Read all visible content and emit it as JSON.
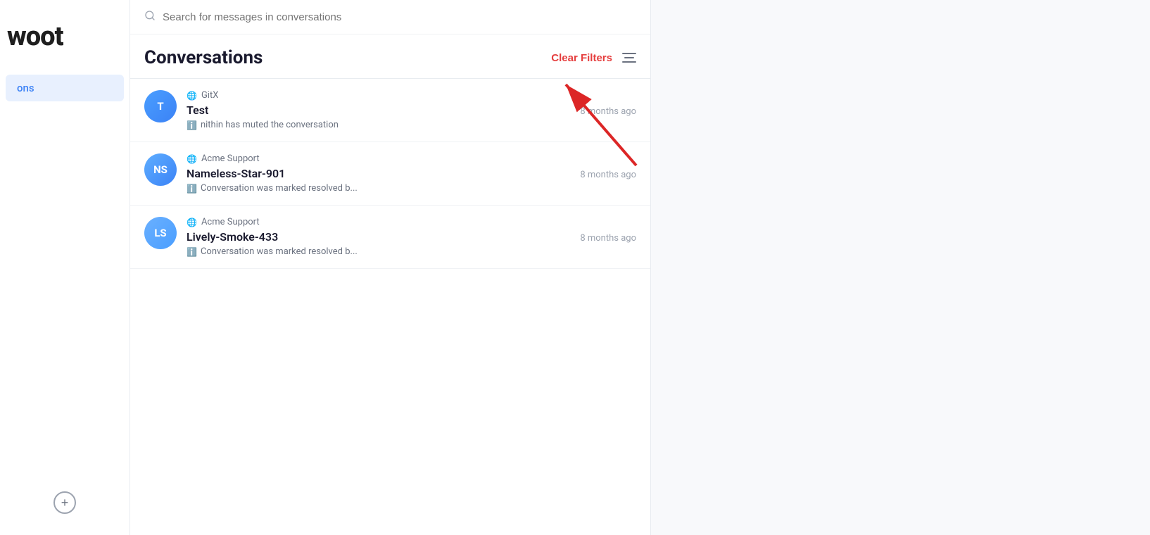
{
  "sidebar": {
    "brand": "woot",
    "nav_item": "ons",
    "add_button": "+"
  },
  "search": {
    "placeholder": "Search for messages in conversations"
  },
  "header": {
    "title": "Conversations",
    "clear_filters": "Clear Filters",
    "filter_icon_label": "filter"
  },
  "conversations": [
    {
      "id": 1,
      "avatar_text": "T",
      "avatar_class": "avatar-t",
      "inbox": "GitX",
      "contact": "Test",
      "time": "8 months ago",
      "message": "nithin has muted the conversation"
    },
    {
      "id": 2,
      "avatar_text": "NS",
      "avatar_class": "avatar-ns",
      "inbox": "Acme Support",
      "contact": "Nameless-Star-901",
      "time": "8 months ago",
      "message": "Conversation was marked resolved b..."
    },
    {
      "id": 3,
      "avatar_text": "LS",
      "avatar_class": "avatar-ls",
      "inbox": "Acme Support",
      "contact": "Lively-Smoke-433",
      "time": "8 months ago",
      "message": "Conversation was marked resolved b..."
    }
  ]
}
